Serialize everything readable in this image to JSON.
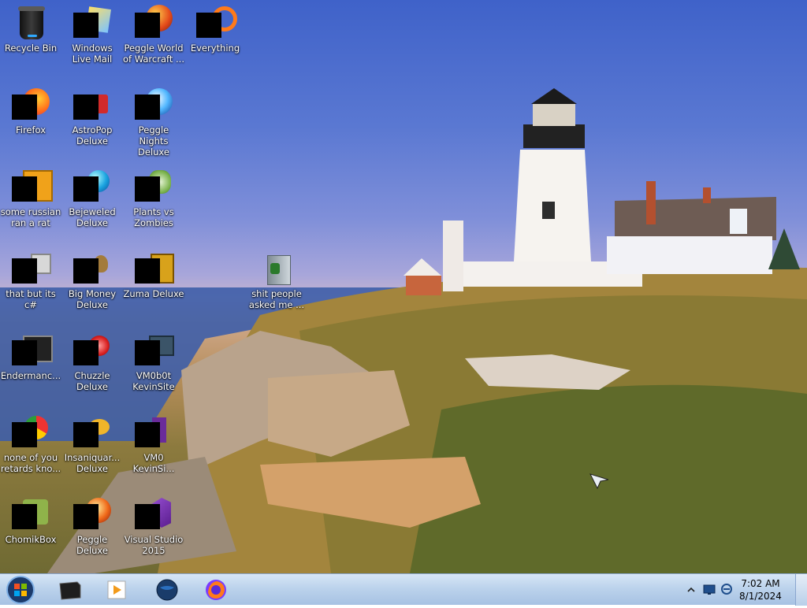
{
  "desktop": {
    "icons": [
      {
        "label": "Recycle Bin",
        "icon": "recycle-bin-icon"
      },
      {
        "label": "Windows Live Mail",
        "icon": "windows-live-mail-icon"
      },
      {
        "label": "Peggle World of Warcraft ...",
        "icon": "peggle-wow-icon"
      },
      {
        "label": "Everything",
        "icon": "everything-search-icon"
      },
      {
        "label": "Firefox",
        "icon": "firefox-icon"
      },
      {
        "label": "AstroPop Deluxe",
        "icon": "astropop-icon"
      },
      {
        "label": "Peggle Nights Deluxe",
        "icon": "peggle-nights-icon"
      },
      {
        "label": "some russian ran a rat",
        "icon": "file-icon"
      },
      {
        "label": "Bejeweled Deluxe",
        "icon": "bejeweled-icon"
      },
      {
        "label": "Plants vs Zombies",
        "icon": "plants-vs-zombies-icon"
      },
      {
        "label": "that but its c#",
        "icon": "shortcut-icon"
      },
      {
        "label": "Big Money Deluxe",
        "icon": "big-money-icon"
      },
      {
        "label": "Zuma Deluxe",
        "icon": "zuma-icon"
      },
      {
        "label": "shit people asked me ...",
        "icon": "folder-icon"
      },
      {
        "label": "Endermanc...",
        "icon": "app-window-icon"
      },
      {
        "label": "Chuzzle Deluxe",
        "icon": "chuzzle-icon"
      },
      {
        "label": "VM0b0t KevinSite",
        "icon": "vm-icon"
      },
      {
        "label": "none of you retards kno...",
        "icon": "chrome-like-icon"
      },
      {
        "label": "Insaniquar... Deluxe",
        "icon": "insaniquarium-icon"
      },
      {
        "label": "VM0 KevinSi...",
        "icon": "visual-studio-file-icon"
      },
      {
        "label": "ChomikBox",
        "icon": "chomikbox-icon"
      },
      {
        "label": "Peggle Deluxe",
        "icon": "peggle-icon"
      },
      {
        "label": "Visual Studio 2015",
        "icon": "visual-studio-icon"
      }
    ]
  },
  "taskbar": {
    "start": "start-orb-icon",
    "pinned": [
      {
        "name": "explorer-icon"
      },
      {
        "name": "media-player-icon"
      },
      {
        "name": "globe-icon"
      },
      {
        "name": "firefox-icon"
      }
    ],
    "tray": {
      "time": "7:02 AM",
      "date": "8/1/2024"
    }
  },
  "colors": {
    "sky_top": "#3f62c9",
    "taskbar": "#bcd3ec",
    "icon_mask": "#000000"
  }
}
